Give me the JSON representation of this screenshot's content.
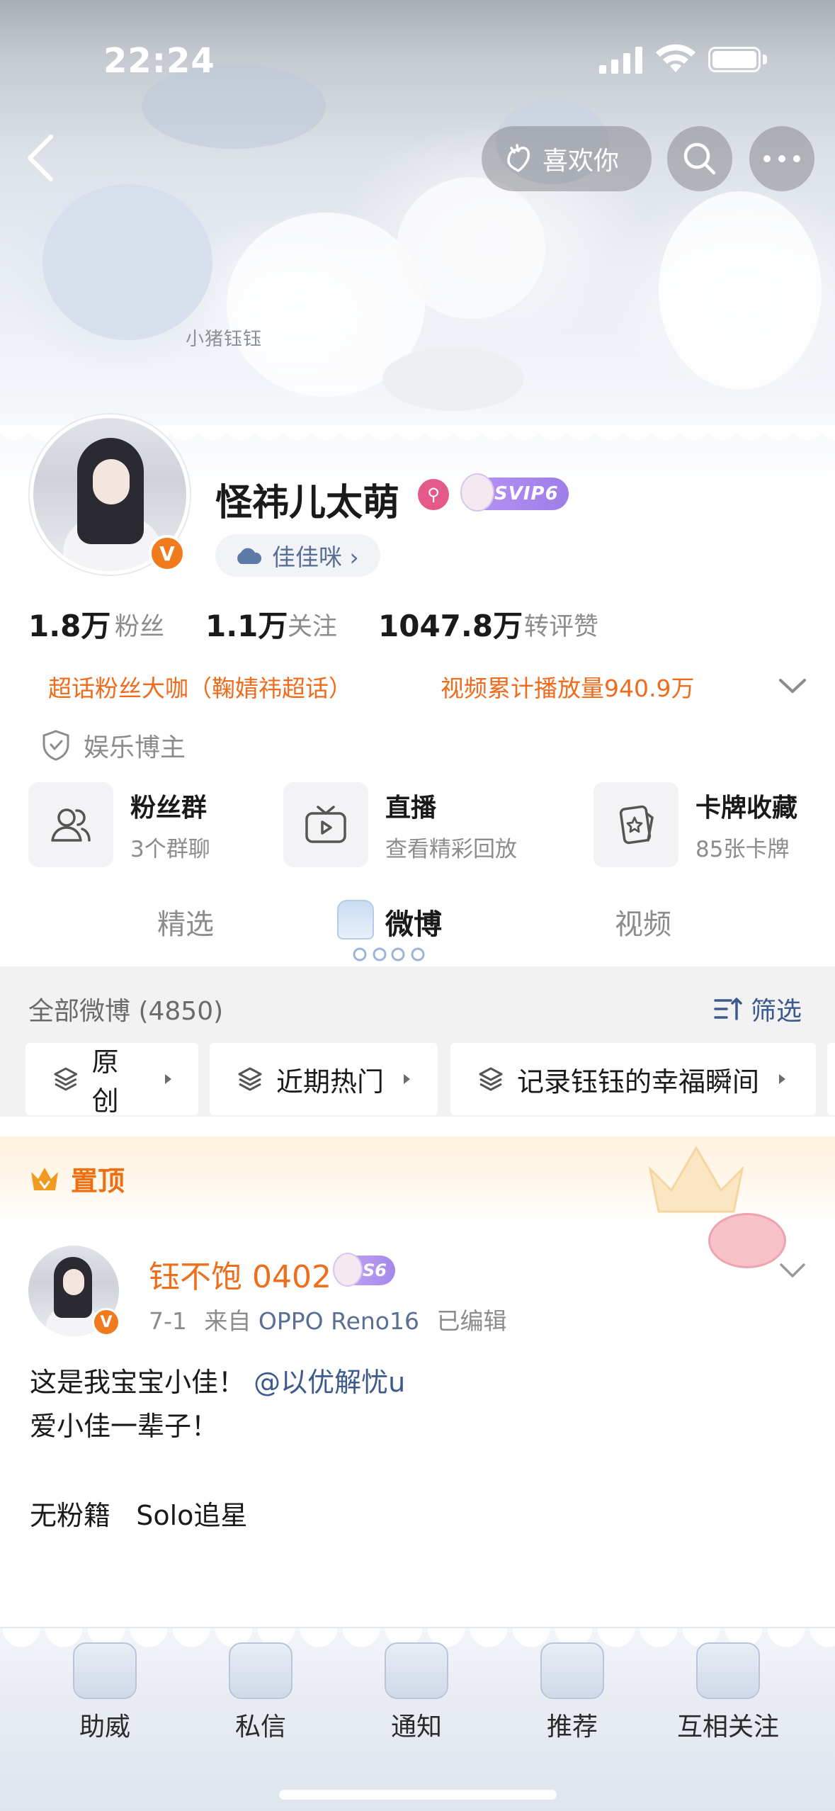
{
  "status_bar": {
    "time": "22:24"
  },
  "header": {
    "watermark": "小猪钰钰",
    "like_label": "喜欢你"
  },
  "profile": {
    "name": "怪祎儿太萌",
    "vip_label": "SVIP6",
    "sub_tag": "佳佳咪 ›",
    "stats": [
      {
        "num": "1.8万",
        "label": "粉丝"
      },
      {
        "num": "1.1万",
        "label": "关注"
      },
      {
        "num": "1047.8万",
        "label": "转评赞"
      }
    ],
    "highlights": [
      "超话粉丝大咖（鞠婧祎超话）",
      "视频累计播放量940.9万"
    ],
    "role": "娱乐博主"
  },
  "features": [
    {
      "title": "粉丝群",
      "sub": "3个群聊",
      "icon": "people-icon"
    },
    {
      "title": "直播",
      "sub": "查看精彩回放",
      "icon": "tv-icon"
    },
    {
      "title": "卡牌收藏",
      "sub": "85张卡牌",
      "icon": "card-icon"
    }
  ],
  "tabs": [
    "精选",
    "微博",
    "视频"
  ],
  "filter": {
    "all_label": "全部微博 (4850)",
    "filter_label": "筛选",
    "chips": [
      "原创",
      "近期热门",
      "记录钰钰的幸福瞬间"
    ]
  },
  "pinned": {
    "label": "置顶",
    "post": {
      "author": "钰不饱 0402",
      "badge": "S6",
      "date": "7-1",
      "from_prefix": "来自",
      "source": "OPPO Reno16",
      "edited": "已编辑",
      "line1_text": "这是我宝宝小佳！",
      "line1_mention": "@以优解忧u",
      "line2": "爱小佳一辈子！",
      "line3": "无粉籍   Solo追星"
    }
  },
  "bottom_bar": [
    "助威",
    "私信",
    "通知",
    "推荐",
    "互相关注"
  ],
  "colors": {
    "accent_orange": "#f06b1b",
    "link_blue": "#3c5a8e",
    "vip_purple": "#a589ea"
  }
}
